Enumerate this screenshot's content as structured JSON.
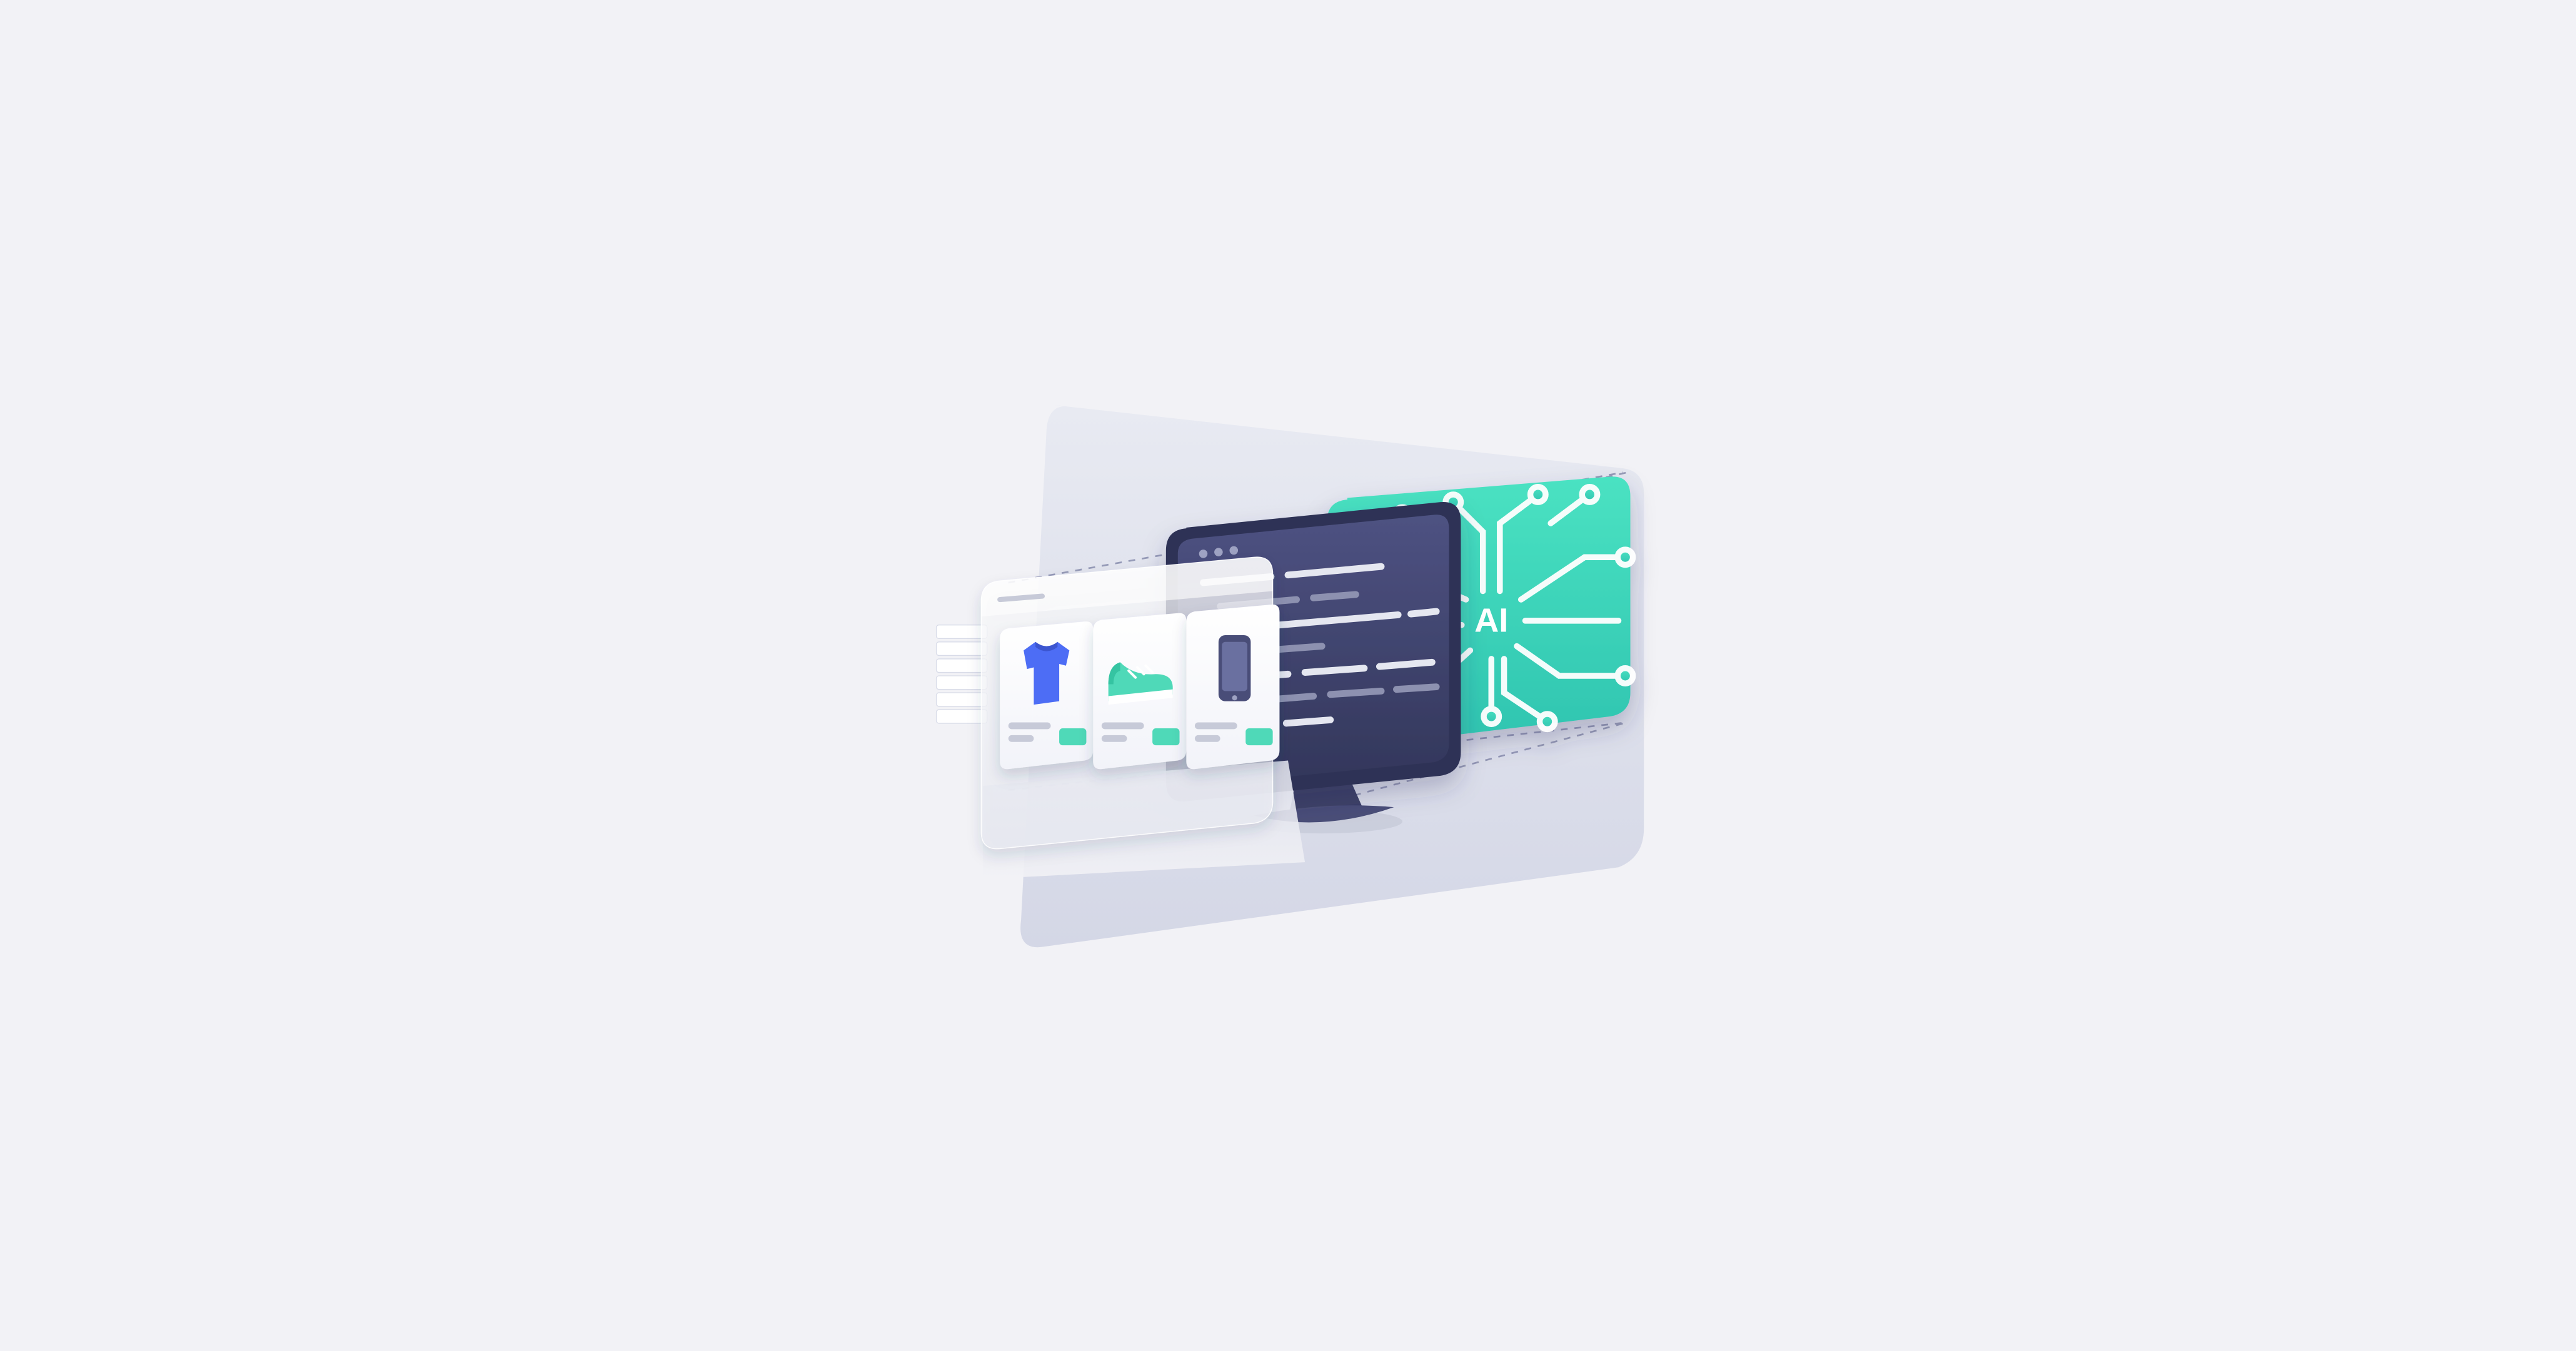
{
  "illustration": {
    "ai_label": "AI",
    "layers": [
      "storefront",
      "code",
      "ai"
    ],
    "products": [
      "tshirt",
      "sneaker",
      "phone"
    ]
  },
  "colors": {
    "bg": "#f2f2f6",
    "panel": "#dde0ec",
    "code_bg_top": "#4a4e78",
    "code_bg_bottom": "#32365a",
    "code_line_light": "#e5e7f0",
    "code_line_dark": "#8d91b0",
    "ai_bg_top": "#3de0bc",
    "ai_bg_bottom": "#2fc4b0",
    "ai_circuit": "#ffffff",
    "tshirt": "#4d6df5",
    "sneaker": "#4fd9b8",
    "phone": "#4a4e78",
    "btn": "#4fd9b8",
    "gray": "#c7cad8"
  }
}
